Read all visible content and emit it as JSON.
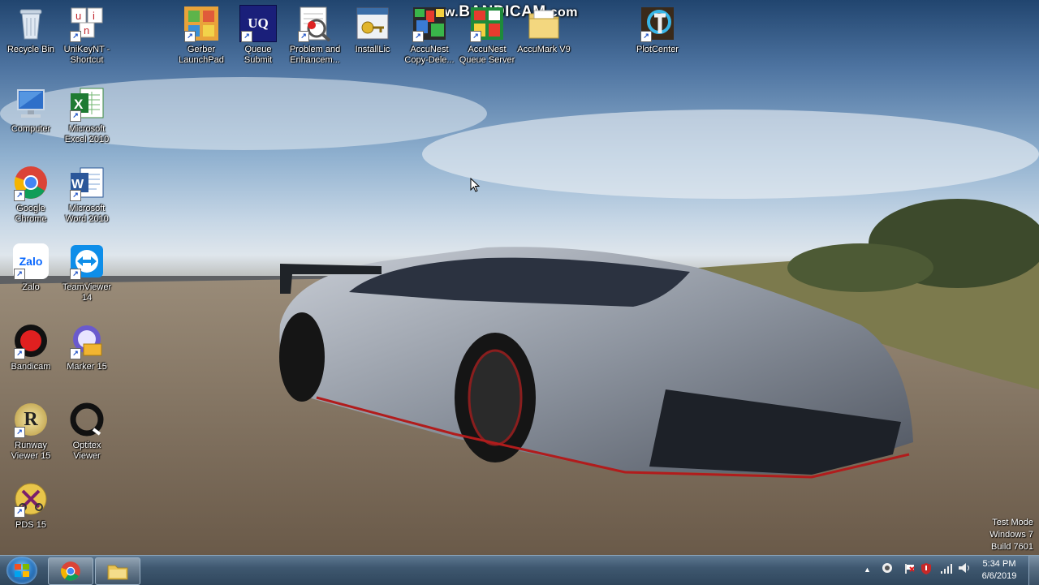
{
  "watermark": {
    "prefix": "www.",
    "brand": "BANDICAM",
    "suffix": ".com"
  },
  "desktop_icons": [
    {
      "name": "recycle-bin-icon",
      "label": "Recycle Bin"
    },
    {
      "name": "unikey-shortcut-icon",
      "label": "UniKeyNT -\nShortcut"
    },
    {
      "name": "gerber-launchpad-icon",
      "label": "Gerber\nLaunchPad"
    },
    {
      "name": "queue-submit-icon",
      "label": "Queue\nSubmit"
    },
    {
      "name": "problem-enhancement-icon",
      "label": "Problem and\nEnhancem..."
    },
    {
      "name": "installlic-icon",
      "label": "InstallLic"
    },
    {
      "name": "accunest-copy-icon",
      "label": "AccuNest\nCopy-Dele..."
    },
    {
      "name": "accunest-queue-server-icon",
      "label": "AccuNest\nQueue Server"
    },
    {
      "name": "accumark-v9-icon",
      "label": "AccuMark V9"
    },
    {
      "name": "plotcenter-icon",
      "label": "PlotCenter"
    },
    {
      "name": "computer-icon",
      "label": "Computer"
    },
    {
      "name": "excel-icon",
      "label": "Microsoft\nExcel 2010"
    },
    {
      "name": "chrome-icon",
      "label": "Google\nChrome"
    },
    {
      "name": "word-icon",
      "label": "Microsoft\nWord 2010"
    },
    {
      "name": "zalo-icon",
      "label": "Zalo"
    },
    {
      "name": "teamviewer-icon",
      "label": "TeamViewer\n14"
    },
    {
      "name": "bandicam-icon",
      "label": "Bandicam"
    },
    {
      "name": "marker-icon",
      "label": "Marker 15"
    },
    {
      "name": "runway-viewer-icon",
      "label": "Runway\nViewer 15"
    },
    {
      "name": "optitex-viewer-icon",
      "label": "Optitex\nViewer"
    },
    {
      "name": "pds-icon",
      "label": "PDS 15"
    }
  ],
  "icon_glyphs": {
    "uq": "UQ",
    "zalo": "Zalo",
    "unikey": [
      "u",
      "i",
      "n"
    ],
    "runway": "R"
  },
  "os_watermark": {
    "line1": "Test Mode",
    "line2": "Windows 7",
    "line3": "Build 7601"
  },
  "taskbar": {
    "pinned": [
      {
        "name": "chrome"
      },
      {
        "name": "file-explorer"
      }
    ],
    "tray": {
      "arrow": "▲"
    },
    "clock": {
      "time": "5:34 PM",
      "date": "6/6/2019"
    }
  },
  "colors": {
    "taskbar": "#3f5870",
    "accent": "#2e7bc4"
  }
}
